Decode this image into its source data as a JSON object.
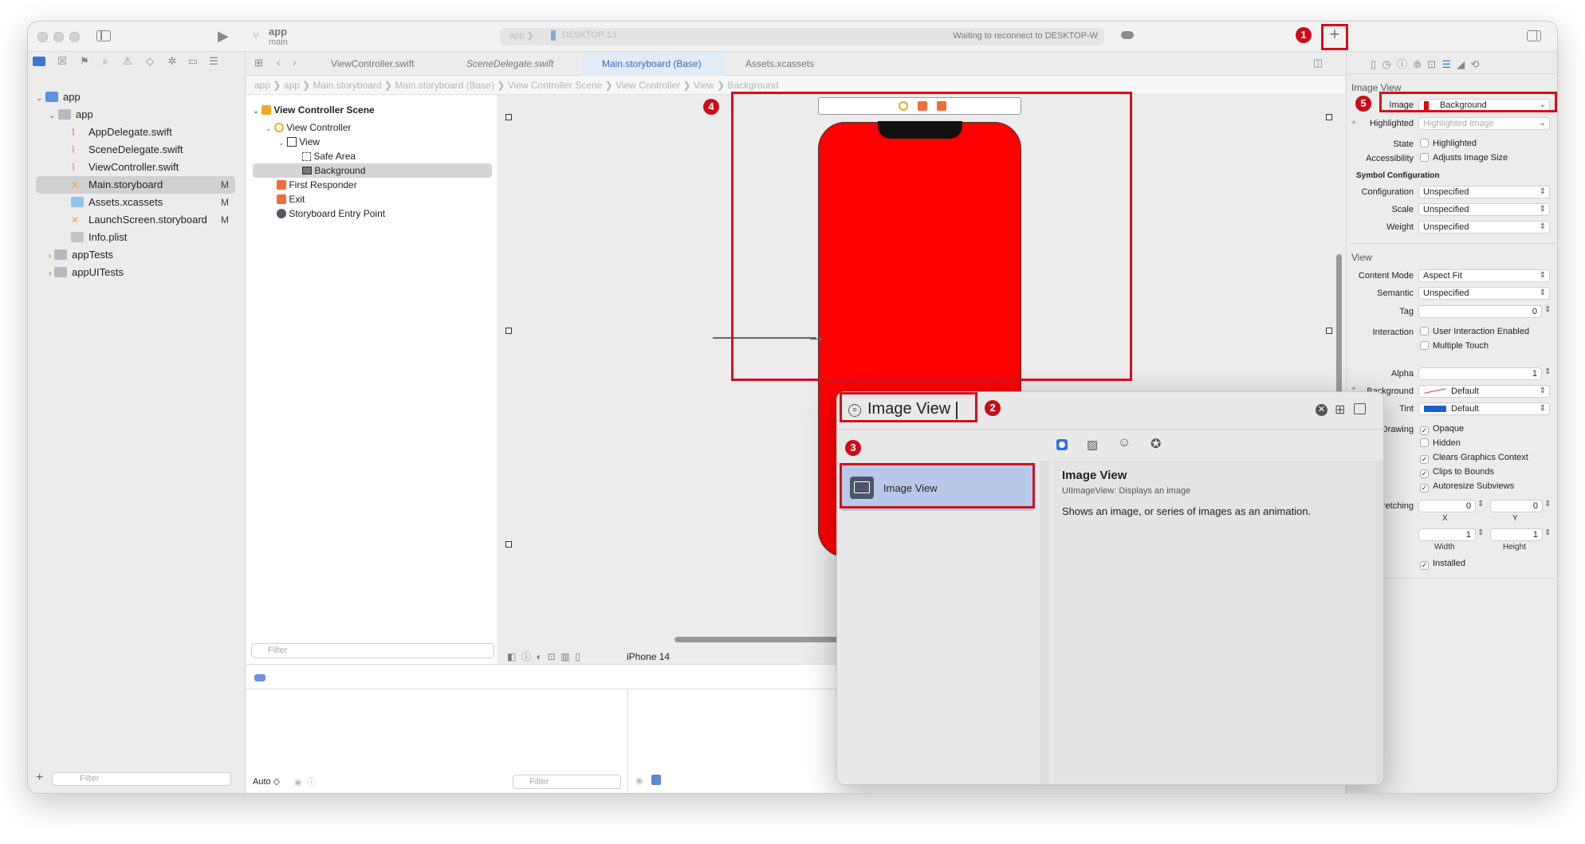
{
  "toolbar": {
    "project_name": "app",
    "branch": "main",
    "scheme_app": "app",
    "scheme_device": "DESKTOP-13",
    "status_text": "Waiting to reconnect to DESKTOP-W",
    "add_symbol": "+"
  },
  "navigator": {
    "items": [
      {
        "label": "app",
        "badge": ""
      },
      {
        "label": "app",
        "badge": ""
      },
      {
        "label": "AppDelegate.swift",
        "badge": ""
      },
      {
        "label": "SceneDelegate.swift",
        "badge": ""
      },
      {
        "label": "ViewController.swift",
        "badge": ""
      },
      {
        "label": "Main.storyboard",
        "badge": "M"
      },
      {
        "label": "Assets.xcassets",
        "badge": "M"
      },
      {
        "label": "LaunchScreen.storyboard",
        "badge": "M"
      },
      {
        "label": "Info.plist",
        "badge": ""
      },
      {
        "label": "appTests",
        "badge": ""
      },
      {
        "label": "appUITests",
        "badge": ""
      }
    ],
    "filter_placeholder": "Filter"
  },
  "tabs": [
    "ViewController.swift",
    "SceneDelegate.swift",
    "Main.storyboard (Base)",
    "Assets.xcassets"
  ],
  "jumpbar": [
    "app",
    "app",
    "Main.storyboard",
    "Main.storyboard (Base)",
    "View Controller Scene",
    "View Controller",
    "View",
    "Background"
  ],
  "outline": {
    "items": [
      "View Controller Scene",
      "View Controller",
      "View",
      "Safe Area",
      "Background",
      "First Responder",
      "Exit",
      "Storyboard Entry Point"
    ],
    "filter_placeholder": "Filter"
  },
  "canvas": {
    "device": "iPhone 14",
    "view_color": "#fe0000"
  },
  "bottom": {
    "auto_label": "Auto ◇",
    "filter_placeholder": "Filter"
  },
  "inspector": {
    "section_image_view": "Image View",
    "image_label": "Image",
    "image_value": "Background",
    "highlighted_label": "Highlighted",
    "highlighted_placeholder": "Highlighted Image",
    "state_label": "State",
    "state_value": "Highlighted",
    "accessibility_label": "Accessibility",
    "accessibility_value": "Adjusts Image Size",
    "symbol_config_title": "Symbol Configuration",
    "configuration_label": "Configuration",
    "configuration_value": "Unspecified",
    "scale_label": "Scale",
    "scale_value": "Unspecified",
    "weight_label": "Weight",
    "weight_value": "Unspecified",
    "section_view": "View",
    "content_mode_label": "Content Mode",
    "content_mode_value": "Aspect Fit",
    "semantic_label": "Semantic",
    "semantic_value": "Unspecified",
    "tag_label": "Tag",
    "tag_value": "0",
    "interaction_label": "Interaction",
    "user_interaction": "User Interaction Enabled",
    "multiple_touch": "Multiple Touch",
    "alpha_label": "Alpha",
    "alpha_value": "1",
    "background_label": "Background",
    "background_value": "Default",
    "tint_label": "Tint",
    "tint_value": "Default",
    "drawing_label": "Drawing",
    "opaque": "Opaque",
    "hidden": "Hidden",
    "clears_graphics": "Clears Graphics Context",
    "clips_bounds": "Clips to Bounds",
    "autoresize": "Autoresize Subviews",
    "stretching_label": "Stretching",
    "stretch_x": "0",
    "stretch_y": "0",
    "x_label": "X",
    "y_label": "Y",
    "stretch_w": "1",
    "stretch_h": "1",
    "width_label": "Width",
    "height_label": "Height",
    "installed": "Installed",
    "tint_color": "#1a5fd6"
  },
  "library": {
    "search_value": "Image View",
    "result_label": "Image View",
    "detail_title": "Image View",
    "detail_subtitle": "UIImageView: Displays an image",
    "detail_description": "Shows an image, or series of images as an animation."
  },
  "callouts": [
    "1",
    "2",
    "3",
    "4",
    "5"
  ],
  "accent_color": "#d20f1c"
}
